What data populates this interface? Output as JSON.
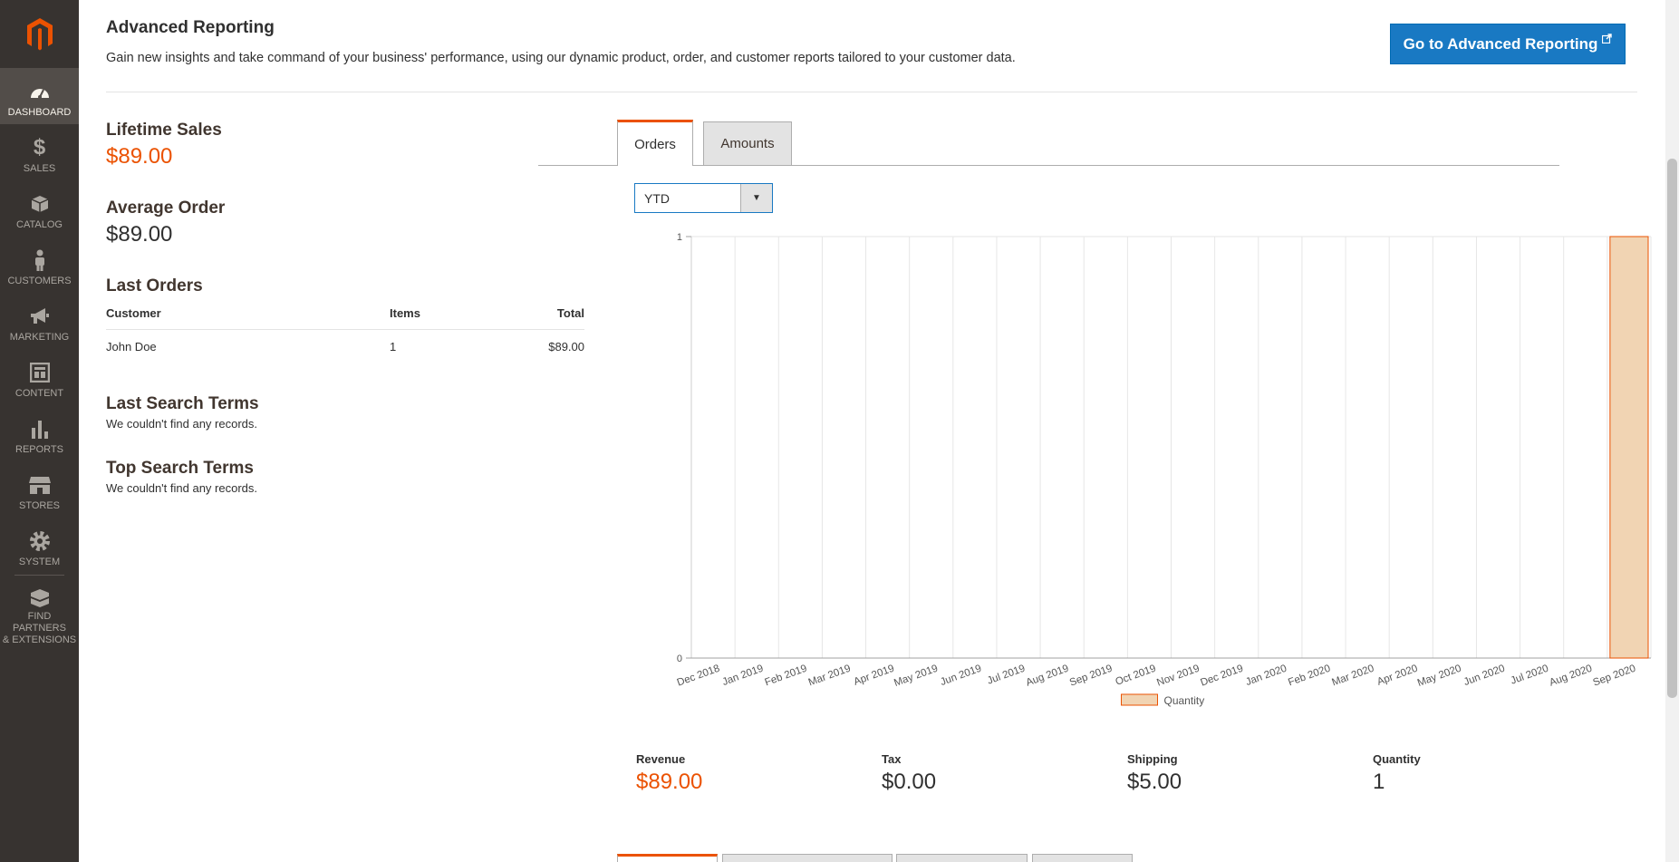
{
  "sidebar": {
    "logo": "magento-logo",
    "items": [
      {
        "label": "DASHBOARD",
        "icon": "dashboard-icon",
        "active": true
      },
      {
        "label": "SALES",
        "icon": "dollar-icon"
      },
      {
        "label": "CATALOG",
        "icon": "box-icon"
      },
      {
        "label": "CUSTOMERS",
        "icon": "person-icon"
      },
      {
        "label": "MARKETING",
        "icon": "megaphone-icon"
      },
      {
        "label": "CONTENT",
        "icon": "layout-icon"
      },
      {
        "label": "REPORTS",
        "icon": "bar-chart-icon"
      },
      {
        "label": "STORES",
        "icon": "storefront-icon"
      },
      {
        "label": "SYSTEM",
        "icon": "gear-icon"
      },
      {
        "label1": "FIND PARTNERS",
        "label2": "& EXTENSIONS",
        "icon": "blocks-icon"
      }
    ]
  },
  "advanced_reporting": {
    "title": "Advanced Reporting",
    "description": "Gain new insights and take command of your business' performance, using our dynamic product, order, and customer reports tailored to your customer data.",
    "button_label": "Go to Advanced Reporting"
  },
  "stats": {
    "lifetime_sales_label": "Lifetime Sales",
    "lifetime_sales_value": "$89.00",
    "average_order_label": "Average Order",
    "average_order_value": "$89.00"
  },
  "last_orders": {
    "title": "Last Orders",
    "columns": [
      "Customer",
      "Items",
      "Total"
    ],
    "rows": [
      [
        "John Doe",
        "1",
        "$89.00"
      ]
    ]
  },
  "last_search_terms": {
    "title": "Last Search Terms",
    "note": "We couldn't find any records."
  },
  "top_search_terms": {
    "title": "Top Search Terms",
    "note": "We couldn't find any records."
  },
  "chart_tabs": [
    {
      "label": "Orders",
      "active": true
    },
    {
      "label": "Amounts",
      "active": false
    }
  ],
  "period_select": {
    "value": "YTD"
  },
  "chart_data": {
    "type": "bar",
    "categories": [
      "Dec 2018",
      "Jan 2019",
      "Feb 2019",
      "Mar 2019",
      "Apr 2019",
      "May 2019",
      "Jun 2019",
      "Jul 2019",
      "Aug 2019",
      "Sep 2019",
      "Oct 2019",
      "Nov 2019",
      "Dec 2019",
      "Jan 2020",
      "Feb 2020",
      "Mar 2020",
      "Apr 2020",
      "May 2020",
      "Jun 2020",
      "Jul 2020",
      "Aug 2020",
      "Sep 2020"
    ],
    "series": [
      {
        "name": "Quantity",
        "values": [
          0,
          0,
          0,
          0,
          0,
          0,
          0,
          0,
          0,
          0,
          0,
          0,
          0,
          0,
          0,
          0,
          0,
          0,
          0,
          0,
          0,
          1
        ]
      }
    ],
    "ylim": [
      0,
      1
    ],
    "yticks": [
      "0",
      "1"
    ],
    "grid": true,
    "legend_position": "bottom-center",
    "bar_fill": "#f1d4b3",
    "bar_stroke": "#eb5202"
  },
  "totals": [
    {
      "label": "Revenue",
      "value": "$89.00",
      "highlight": true
    },
    {
      "label": "Tax",
      "value": "$0.00"
    },
    {
      "label": "Shipping",
      "value": "$5.00"
    },
    {
      "label": "Quantity",
      "value": "1"
    }
  ],
  "colors": {
    "accent": "#eb5202",
    "primary_button": "#1979c3",
    "sidebar": "#373330"
  }
}
